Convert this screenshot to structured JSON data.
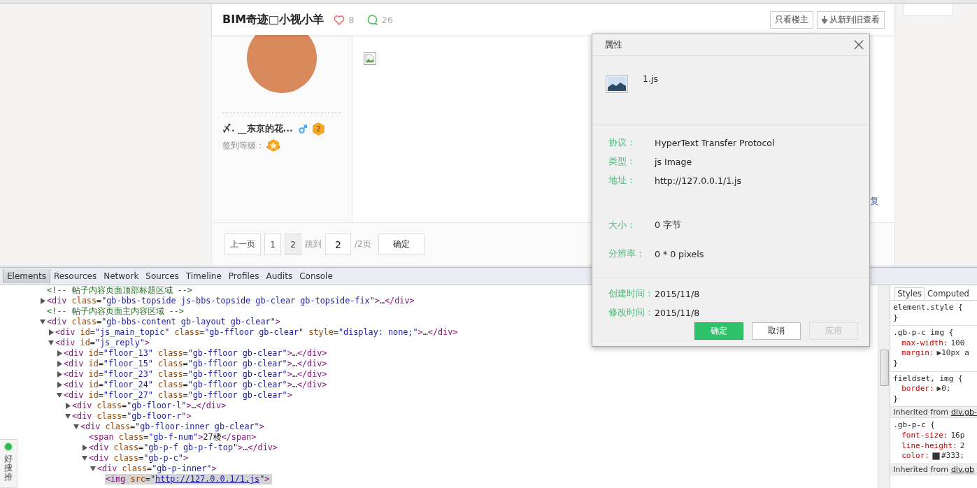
{
  "browser_page": {
    "post_header": {
      "title": "BIM奇迹□小视小羊",
      "likes": "8",
      "comments": "26"
    },
    "header_buttons": [
      {
        "kind": "plain",
        "label": "只看楼主"
      },
      {
        "kind": "sort",
        "label": "从新到旧查看"
      }
    ],
    "author": {
      "name": "〆. __东京的花...",
      "level": "2",
      "checkin_label": "签到等级："
    },
    "reply_link": "复",
    "pagination": {
      "prev": "上一页",
      "pages": [
        {
          "label": "1",
          "selected": false
        },
        {
          "label": "2",
          "selected": true
        }
      ],
      "jump_label": "跳到",
      "jump_value": "2",
      "total": "/2页",
      "confirm": "确定"
    }
  },
  "properties_dialog": {
    "title": "属性",
    "file_name": "1.js",
    "sections": [
      {
        "rows": [
          {
            "label": "协议：",
            "value": "HyperText Transfer Protocol"
          },
          {
            "label": "类型：",
            "value": "js Image"
          },
          {
            "label": "地址：",
            "value": "http://127.0.0.1/1.js"
          }
        ]
      },
      {
        "rows": [
          {
            "label": "大小：",
            "value": "0 字节"
          }
        ]
      },
      {
        "rows": [
          {
            "label": "分辨率：",
            "value": "0 * 0 pixels"
          }
        ]
      }
    ],
    "dates": [
      {
        "label": "创建时间：",
        "value": "2015/11/8"
      },
      {
        "label": "修改时间：",
        "value": "2015/11/8"
      }
    ],
    "buttons": [
      {
        "label": "确定",
        "kind": "primary",
        "disabled": false
      },
      {
        "label": "取消",
        "kind": "normal",
        "disabled": false
      },
      {
        "label": "应用",
        "kind": "normal",
        "disabled": true
      }
    ]
  },
  "devtools": {
    "tabs": [
      {
        "label": "Elements",
        "selected": true
      },
      {
        "label": "Resources",
        "selected": false
      },
      {
        "label": "Network",
        "selected": false
      },
      {
        "label": "Sources",
        "selected": false
      },
      {
        "label": "Timeline",
        "selected": false
      },
      {
        "label": "Profiles",
        "selected": false
      },
      {
        "label": "Audits",
        "selected": false
      },
      {
        "label": "Console",
        "selected": false
      }
    ],
    "dom_tree": [
      {
        "kind": "comment",
        "text": "<!-- 帖子内容页面顶部标题区域 -->",
        "selected": false
      },
      {
        "kind": "element",
        "text": "<div class=\"gb-bbs-topside js-bbs-topside gb-clear gb-topside-fix\">…</div>",
        "expanded": false,
        "selected": false
      },
      {
        "kind": "comment",
        "text": "<!-- 帖子内容页面主内容区域 -->",
        "selected": false
      },
      {
        "kind": "element",
        "text": "<div class=\"gb-bbs-content gb-layout gb-clear\">",
        "expanded": true,
        "selected": false,
        "children": [
          {
            "kind": "element",
            "text": "<div id=\"js_main_topic\" class=\"gb-ffloor gb-clear\" style=\"display: none;\">…</div>",
            "expanded": false,
            "selected": false
          },
          {
            "kind": "element",
            "text": "<div id=\"js_reply\">",
            "expanded": true,
            "selected": false,
            "children": [
              {
                "kind": "element",
                "text": "<div id=\"floor_13\" class=\"gb-ffloor gb-clear\">…</div>",
                "expanded": false,
                "selected": false
              },
              {
                "kind": "element",
                "text": "<div id=\"floor_15\" class=\"gb-ffloor gb-clear\">…</div>",
                "expanded": false,
                "selected": false
              },
              {
                "kind": "element",
                "text": "<div id=\"floor_23\" class=\"gb-ffloor gb-clear\">…</div>",
                "expanded": false,
                "selected": false
              },
              {
                "kind": "element",
                "text": "<div id=\"floor_24\" class=\"gb-ffloor gb-clear\">…</div>",
                "expanded": false,
                "selected": false
              },
              {
                "kind": "element",
                "text": "<div id=\"floor_27\" class=\"gb-ffloor gb-clear\">",
                "expanded": true,
                "selected": false,
                "children": [
                  {
                    "kind": "element",
                    "text": "<div class=\"gb-floor-l\">…</div>",
                    "expanded": false,
                    "selected": false
                  },
                  {
                    "kind": "element",
                    "text": "<div class=\"gb-floor-r\">",
                    "expanded": true,
                    "selected": false,
                    "children": [
                      {
                        "kind": "element",
                        "text": "<div class=\"gb-floor-inner gb-clear\">",
                        "expanded": true,
                        "selected": false,
                        "children": [
                          {
                            "kind": "element",
                            "text": "<span class=\"gb-f-num\">27楼</span>",
                            "selected": false
                          },
                          {
                            "kind": "element",
                            "text": "<div class=\"gb-p-f gb-p-f-top\">…</div>",
                            "expanded": false,
                            "selected": false
                          },
                          {
                            "kind": "element",
                            "text": "<div class=\"gb-p-c\">",
                            "expanded": true,
                            "selected": false,
                            "children": [
                              {
                                "kind": "element",
                                "text": "<div class=\"gb-p-inner\">",
                                "expanded": true,
                                "selected": false,
                                "children": [
                                  {
                                    "kind": "element",
                                    "text": "<img src=\"http://127.0.0.1/1.js\">",
                                    "selected": true,
                                    "link": true
                                  }
                                ]
                              }
                            ]
                          }
                        ]
                      }
                    ]
                  }
                ]
              }
            ]
          }
        ]
      }
    ],
    "styles_tabs": [
      {
        "label": "Styles",
        "selected": true
      },
      {
        "label": "Computed",
        "selected": false
      }
    ],
    "style_rules": [
      {
        "kind": "rule",
        "selector": "element.style {",
        "close": "}"
      },
      {
        "kind": "rule",
        "selector": ".gb-p-c img {",
        "declarations": [
          {
            "property": "max-width:",
            "value": "100"
          },
          {
            "property": "margin:",
            "value": "▶10px a"
          }
        ],
        "close": "}"
      },
      {
        "kind": "rule",
        "selector": "fieldset, img {",
        "declarations": [
          {
            "property": "border:",
            "value": "▶0;"
          }
        ],
        "close": "}"
      },
      {
        "kind": "inherited",
        "label": "Inherited from",
        "link": "div.gb-"
      },
      {
        "kind": "rule",
        "selector": ".gb-p-c {",
        "declarations": [
          {
            "property": "font-size:",
            "value": "16p"
          },
          {
            "property": "line-height:",
            "value": "2"
          },
          {
            "property": "color:",
            "value": "#333;",
            "color": "#333333"
          }
        ]
      },
      {
        "kind": "inherited",
        "label": "Inherited from",
        "link": "div.gb"
      }
    ]
  },
  "side_widget": {
    "label": "好搜推"
  }
}
